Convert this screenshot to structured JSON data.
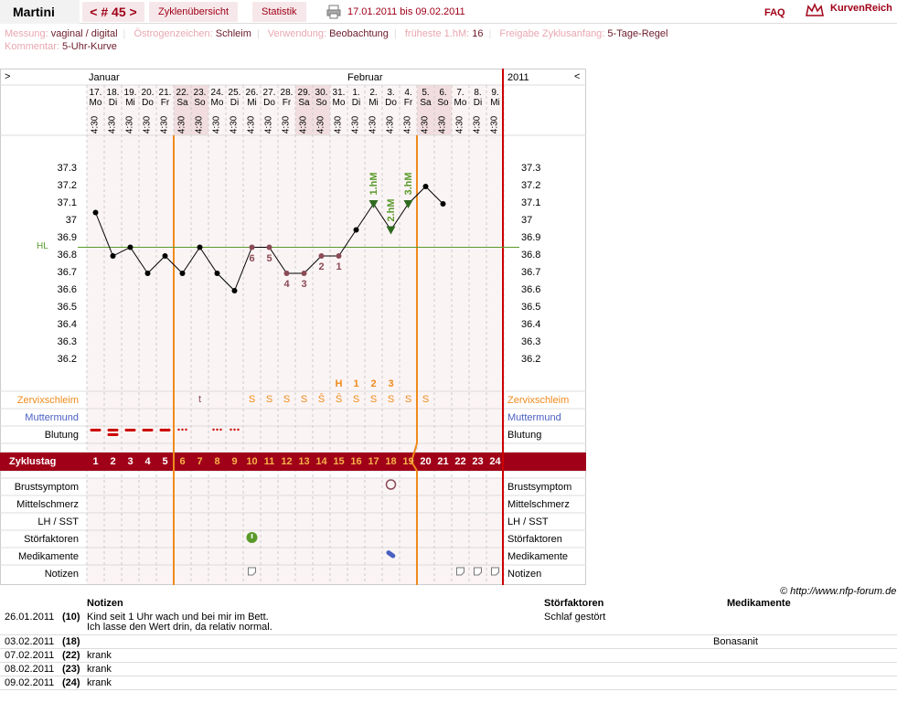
{
  "topbar": {
    "user": "Martini",
    "cycle": "< # 45 >",
    "tab_overview": "Zyklenübersicht",
    "tab_stats": "Statistik",
    "printer_icon": "printer-icon",
    "date_range": "17.01.2011 bis 09.02.2011",
    "faq": "FAQ",
    "logo": "KurvenReich",
    "logo_icon": "crown-icon"
  },
  "meta": {
    "messung_k": "Messung:",
    "messung_v": "vaginal / digital",
    "oestrogen_k": "Östrogenzeichen:",
    "oestrogen_v": "Schleim",
    "verwendung_k": "Verwendung:",
    "verwendung_v": "Beobachtung",
    "hm_k": "früheste 1.hM:",
    "hm_v": "16",
    "freigabe_k": "Freigabe Zyklusanfang:",
    "freigabe_v": "5-Tage-Regel",
    "kommentar_k": "Kommentar:",
    "kommentar_v": "5-Uhr-Kurve"
  },
  "chart_header": {
    "left_arrow": ">",
    "right_arrow": "<",
    "month1": "Januar",
    "month2": "Februar",
    "year": "2011"
  },
  "days": [
    {
      "d": "17.",
      "w": "Mo",
      "t": "4:30"
    },
    {
      "d": "18.",
      "w": "Di",
      "t": "4:30"
    },
    {
      "d": "19.",
      "w": "Mi",
      "t": "4:30"
    },
    {
      "d": "20.",
      "w": "Do",
      "t": "4:30"
    },
    {
      "d": "21.",
      "w": "Fr",
      "t": "4:30"
    },
    {
      "d": "22.",
      "w": "Sa",
      "t": "4:30"
    },
    {
      "d": "23.",
      "w": "So",
      "t": "4:30"
    },
    {
      "d": "24.",
      "w": "Mo",
      "t": "4:30"
    },
    {
      "d": "25.",
      "w": "Di",
      "t": "4:30"
    },
    {
      "d": "26.",
      "w": "Mi",
      "t": "4:30"
    },
    {
      "d": "27.",
      "w": "Do",
      "t": "4:30"
    },
    {
      "d": "28.",
      "w": "Fr",
      "t": "4:30"
    },
    {
      "d": "29.",
      "w": "Sa",
      "t": "4:30"
    },
    {
      "d": "30.",
      "w": "So",
      "t": "4:30"
    },
    {
      "d": "31.",
      "w": "Mo",
      "t": "4:30"
    },
    {
      "d": "1.",
      "w": "Di",
      "t": "4:30"
    },
    {
      "d": "2.",
      "w": "Mi",
      "t": "4:30"
    },
    {
      "d": "3.",
      "w": "Do",
      "t": "4:30"
    },
    {
      "d": "4.",
      "w": "Fr",
      "t": "4:30"
    },
    {
      "d": "5.",
      "w": "Sa",
      "t": "4:30"
    },
    {
      "d": "6.",
      "w": "So",
      "t": "4:30"
    },
    {
      "d": "7.",
      "w": "Mo",
      "t": "4:30"
    },
    {
      "d": "8.",
      "w": "Di",
      "t": "4:30"
    },
    {
      "d": "9.",
      "w": "Mi",
      "t": "4:30"
    }
  ],
  "weekend_idx": [
    5,
    6,
    12,
    13,
    19,
    20
  ],
  "y_ticks": [
    "37.3",
    "37.2",
    "37.1",
    "37",
    "36.9",
    "36.8",
    "36.7",
    "36.6",
    "36.5",
    "36.4",
    "36.3",
    "36.2"
  ],
  "hl_label": "HL",
  "chart_data": {
    "type": "line",
    "x": [
      "17.01.",
      "18.01.",
      "19.01.",
      "20.01.",
      "21.01.",
      "22.01.",
      "23.01.",
      "24.01.",
      "25.01.",
      "26.01.",
      "27.01.",
      "28.01.",
      "29.01.",
      "30.01.",
      "31.01.",
      "01.02.",
      "02.02.",
      "03.02.",
      "04.02.",
      "05.02.",
      "06.02."
    ],
    "values": [
      37.05,
      36.8,
      36.85,
      36.7,
      36.8,
      36.7,
      36.85,
      36.7,
      36.6,
      36.85,
      36.85,
      36.7,
      36.7,
      36.8,
      36.8,
      36.95,
      37.1,
      36.95,
      37.1,
      37.2,
      37.1
    ],
    "ylim": [
      36.2,
      37.3
    ],
    "coverline": 36.85
  },
  "low_labels": [
    {
      "i": 9,
      "t": "6"
    },
    {
      "i": 10,
      "t": "5"
    },
    {
      "i": 11,
      "t": "4"
    },
    {
      "i": 12,
      "t": "3"
    },
    {
      "i": 13,
      "t": "2"
    },
    {
      "i": 14,
      "t": "1"
    }
  ],
  "hm_labels": [
    {
      "i": 16,
      "t": "1.hM"
    },
    {
      "i": 17,
      "t": "2.hM"
    },
    {
      "i": 18,
      "t": "3.hM"
    }
  ],
  "h_labels": [
    {
      "i": 14,
      "t": "H"
    },
    {
      "i": 15,
      "t": "1"
    },
    {
      "i": 16,
      "t": "2"
    },
    {
      "i": 17,
      "t": "3"
    }
  ],
  "rows": {
    "zervix": "Zervixschleim",
    "muttermund": "Muttermund",
    "blutung": "Blutung",
    "zyklustag": "Zyklustag",
    "brust": "Brustsymptom",
    "mittel": "Mittelschmerz",
    "lh": "LH / SST",
    "stoer": "Störfaktoren",
    "medi": "Medikamente",
    "notizen": "Notizen"
  },
  "zervix_marks": [
    {
      "i": 6,
      "t": "t"
    },
    {
      "i": 9,
      "t": "S"
    },
    {
      "i": 10,
      "t": "S"
    },
    {
      "i": 11,
      "t": "S"
    },
    {
      "i": 12,
      "t": "S"
    },
    {
      "i": 13,
      "t": "Ŝ"
    },
    {
      "i": 14,
      "t": "Ŝ"
    },
    {
      "i": 15,
      "t": "S"
    },
    {
      "i": 16,
      "t": "S"
    },
    {
      "i": 17,
      "t": "S"
    },
    {
      "i": 18,
      "t": "S"
    },
    {
      "i": 19,
      "t": "S"
    }
  ],
  "zyklustage": [
    "1",
    "2",
    "3",
    "4",
    "5",
    "6",
    "7",
    "8",
    "9",
    "10",
    "11",
    "12",
    "13",
    "14",
    "15",
    "16",
    "17",
    "18",
    "19",
    "20",
    "21",
    "22",
    "23",
    "24"
  ],
  "copyright": "© http://www.nfp-forum.de",
  "table": {
    "h_notes": "Notizen",
    "h_stoer": "Störfaktoren",
    "h_medi": "Medikamente",
    "rows": [
      {
        "date": "26.01.2011",
        "day": "(10)",
        "note": "Kind seit 1 Uhr wach und bei mir im Bett.",
        "note2": "Ich lasse den Wert drin, da relativ normal.",
        "stoer": "Schlaf gestört",
        "medi": ""
      },
      {
        "date": "03.02.2011",
        "day": "(18)",
        "note": "",
        "note2": "",
        "stoer": "",
        "medi": "Bonasanit"
      },
      {
        "date": "07.02.2011",
        "day": "(22)",
        "note": "krank",
        "note2": "",
        "stoer": "",
        "medi": ""
      },
      {
        "date": "08.02.2011",
        "day": "(23)",
        "note": "krank",
        "note2": "",
        "stoer": "",
        "medi": ""
      },
      {
        "date": "09.02.2011",
        "day": "(24)",
        "note": "krank",
        "note2": "",
        "stoer": "",
        "medi": ""
      }
    ]
  }
}
